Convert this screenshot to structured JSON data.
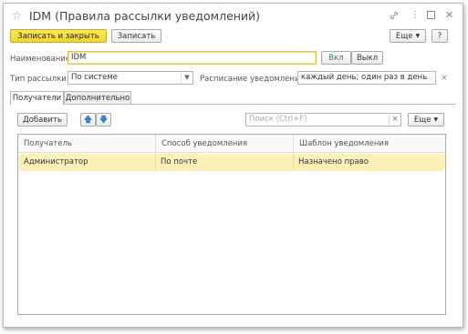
{
  "window": {
    "title": "IDM (Правила рассылки уведомлений)",
    "icons": [
      "star-icon",
      "link-icon",
      "more-vert-icon",
      "maximize-icon",
      "close-icon"
    ]
  },
  "toolbar": {
    "save_close_label": "Записать и закрыть",
    "save_label": "Записать",
    "more_label": "Еще",
    "help_label": "?"
  },
  "form": {
    "name_label": "Наименование:",
    "name_value": "IDM",
    "on_label": "Вкл",
    "off_label": "Выкл",
    "mailing_type_label": "Тип рассылки:",
    "mailing_type_value": "По системе",
    "schedule_label": "Расписание уведомлений:",
    "schedule_value": "каждый день; один раз в день"
  },
  "tabs": [
    {
      "label": "Получатели",
      "active": true
    },
    {
      "label": "Дополнительно",
      "active": false
    }
  ],
  "recipients": {
    "add_label": "Добавить",
    "search_placeholder": "Поиск (Ctrl+F)",
    "more_label": "Еще",
    "columns": [
      "Получатель",
      "Способ уведомления",
      "Шаблон уведомления"
    ],
    "rows": [
      {
        "recipient": "Администратор",
        "method": "По почте",
        "template": "Назначено право"
      }
    ]
  },
  "colors": {
    "primary_button": "#f2d52c",
    "selected_row": "#fbf0b8",
    "on_toggle_text": "#2e8b3a"
  }
}
